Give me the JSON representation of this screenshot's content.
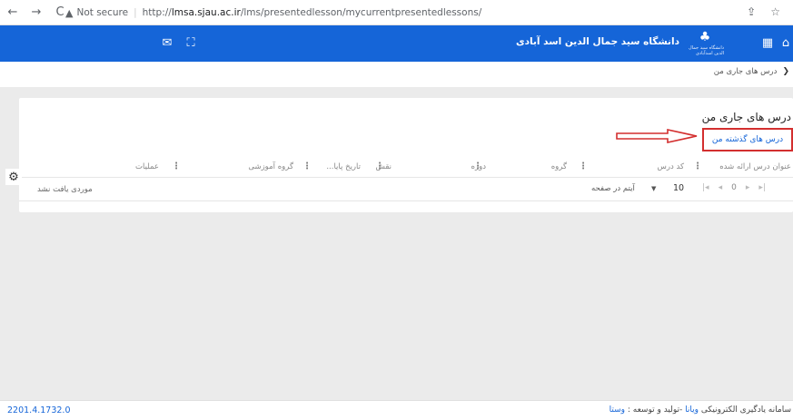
{
  "browser": {
    "back_icon": "←",
    "forward_icon": "→",
    "reload_icon": "C",
    "warning_icon": "▲",
    "security_text": "Not secure",
    "url_prefix": "http://",
    "url_domain": "lmsa.sjau.ac.ir",
    "url_path": "/lms/presentedlesson/mycurrentpresentedlessons/",
    "share_icon": "⇪",
    "star_icon": "☆"
  },
  "appbar": {
    "university_name": "دانشگاه سید جمال الدین اسد آبادی",
    "logo_caption": "دانشگاه سید جمال الدین اسدآبادی",
    "logo_glyph": "♣",
    "grid_icon": "▦",
    "home_icon": "⌂",
    "mail_icon": "✉",
    "fullscreen_icon": "⛶",
    "accent_color": "#1565d8"
  },
  "breadcrumb": {
    "chevron": "❮",
    "current": "درس های جاری من"
  },
  "page": {
    "title": "درس های جاری من",
    "past_lessons_button": "درس های گذشته من",
    "highlight_color": "#d32f2f"
  },
  "table": {
    "columns": [
      "عنوان درس ارائه شده",
      "کد درس",
      "گروه",
      "دوره",
      "نقش",
      "تاریخ پایا...",
      "گروه آموزشی",
      "عملیات"
    ],
    "empty_text": "موردی یافت نشد",
    "per_page_label": "آیتم در صفحه",
    "page_size": "10",
    "page_number": "0"
  },
  "footer": {
    "version": "2201.4.1732.0",
    "credits_prefix": "سامانه یادگیری الکترونیکی",
    "credits_product": "ویانا",
    "credits_middle": "-تولید و توسعه :",
    "credits_company": "وستا"
  }
}
